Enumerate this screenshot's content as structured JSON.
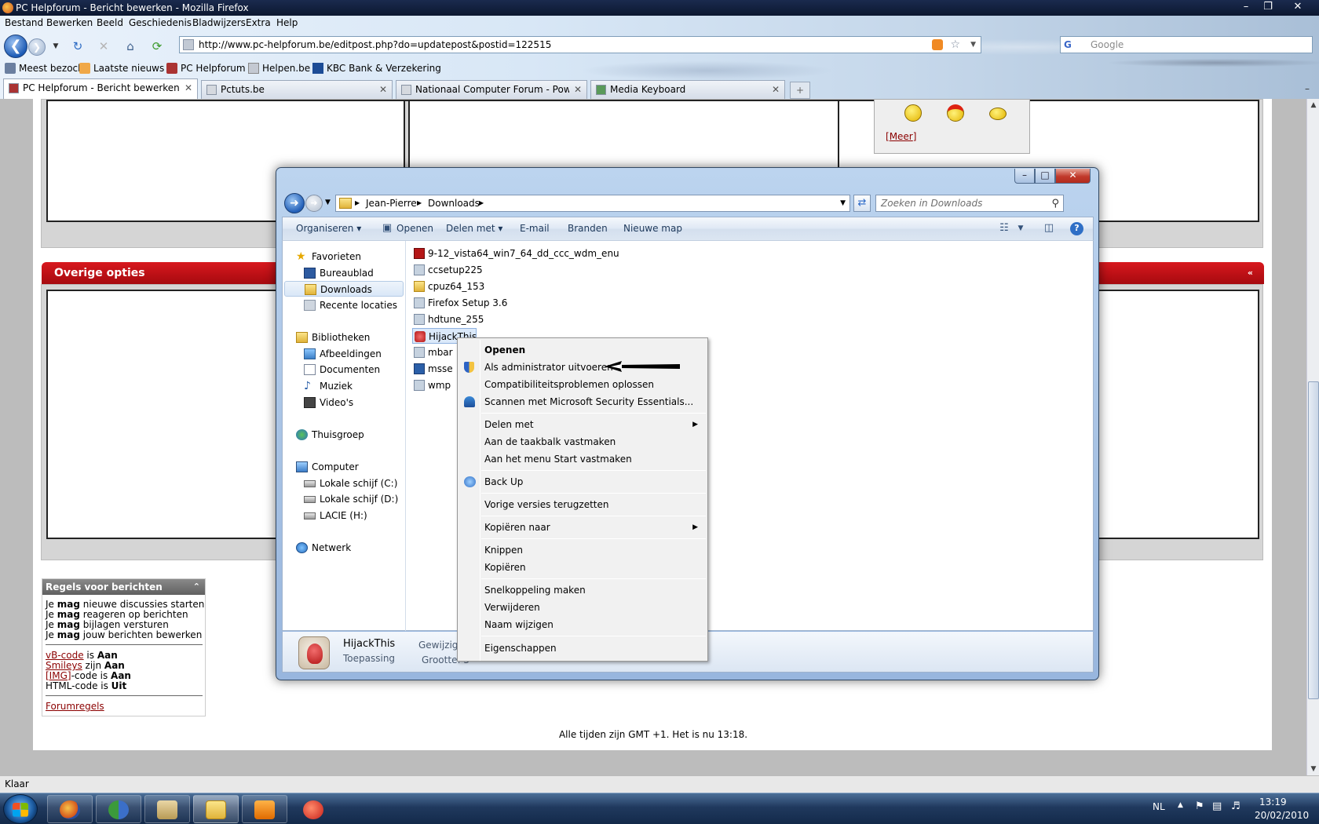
{
  "browser": {
    "title": "PC Helpforum - Bericht bewerken - Mozilla Firefox",
    "menu": [
      "Bestand",
      "Bewerken",
      "Beeld",
      "Geschiedenis",
      "Bladwijzers",
      "Extra",
      "Help"
    ],
    "url": "http://www.pc-helpforum.be/editpost.php?do=updatepost&postid=122515",
    "search_placeholder": "Google",
    "bookmarks": [
      "Meest bezocht",
      "Laatste nieuws",
      "PC Helpforum",
      "Helpen.be",
      "KBC Bank & Verzekering"
    ],
    "tabs": [
      {
        "label": "PC Helpforum - Bericht bewerken",
        "active": true
      },
      {
        "label": "Pctuts.be",
        "active": false
      },
      {
        "label": "Nationaal Computer Forum - Powe...",
        "active": false
      },
      {
        "label": "Media Keyboard",
        "active": false
      }
    ],
    "status": "Klaar"
  },
  "page": {
    "more_link": "Meer",
    "section_header": "Overige opties",
    "rules": {
      "header": "Regels voor berichten",
      "lines": [
        {
          "pre": "Je ",
          "b": "mag",
          "post": " nieuwe discussies starten"
        },
        {
          "pre": "Je ",
          "b": "mag",
          "post": " reageren op berichten"
        },
        {
          "pre": "Je ",
          "b": "mag",
          "post": " bijlagen versturen"
        },
        {
          "pre": "Je ",
          "b": "mag",
          "post": " jouw berichten bewerken"
        }
      ],
      "codes": [
        {
          "link": "vB-code",
          "mid": " is ",
          "b": "Aan"
        },
        {
          "link": "Smileys",
          "mid": " zijn ",
          "b": "Aan"
        },
        {
          "link": "[IMG]",
          "mid": "-code is ",
          "b": "Aan"
        },
        {
          "link": "",
          "mid": "HTML-code is ",
          "b": "Uit"
        }
      ],
      "forum_rules": "Forumregels"
    },
    "time_line": "Alle tijden zijn GMT +1. Het is nu 13:18."
  },
  "explorer": {
    "breadcrumb": [
      "Jean-Pierre",
      "Downloads"
    ],
    "search_placeholder": "Zoeken in Downloads",
    "toolbar": [
      "Organiseren",
      "Openen",
      "Delen met",
      "E-mail",
      "Branden",
      "Nieuwe map"
    ],
    "nav": {
      "favorieten": "Favorieten",
      "bureaublad": "Bureaublad",
      "downloads": "Downloads",
      "recente": "Recente locaties",
      "bibliotheken": "Bibliotheken",
      "afbeeldingen": "Afbeeldingen",
      "documenten": "Documenten",
      "muziek": "Muziek",
      "videos": "Video's",
      "thuisgroep": "Thuisgroep",
      "computer": "Computer",
      "c": "Lokale schijf (C:)",
      "d": "Lokale schijf (D:)",
      "h": "LACIE (H:)",
      "netwerk": "Netwerk"
    },
    "files": [
      "9-12_vista64_win7_64_dd_ccc_wdm_enu",
      "ccsetup225",
      "cpuz64_153",
      "Firefox Setup 3.6",
      "hdtune_255",
      "HijackThis",
      "mbar",
      "msse",
      "wmp"
    ],
    "details": {
      "name": "HijackThis",
      "type": "Toepassing",
      "modified_label": "Gewijzigd op: 8",
      "size_label": "Grootte: 3"
    }
  },
  "context_menu": {
    "items": [
      {
        "label": "Openen",
        "bold": true
      },
      {
        "label": "Als administrator uitvoeren",
        "icon": "shield-icon"
      },
      {
        "label": "Compatibiliteitsproblemen oplossen"
      },
      {
        "label": "Scannen met Microsoft Security Essentials...",
        "icon": "mse-icon"
      },
      {
        "label": "Delen met",
        "submenu": true
      },
      {
        "label": "Aan de taakbalk vastmaken"
      },
      {
        "label": "Aan het menu Start vastmaken"
      },
      {
        "label": "Back Up",
        "icon": "backup-icon"
      },
      {
        "label": "Vorige versies terugzetten"
      },
      {
        "label": "Kopiëren naar",
        "submenu": true
      },
      {
        "label": "Knippen"
      },
      {
        "label": "Kopiëren"
      },
      {
        "label": "Snelkoppeling maken"
      },
      {
        "label": "Verwijderen"
      },
      {
        "label": "Naam wijzigen"
      },
      {
        "label": "Eigenschappen"
      }
    ]
  },
  "taskbar": {
    "lang": "NL",
    "time": "13:19",
    "date": "20/02/2010"
  }
}
